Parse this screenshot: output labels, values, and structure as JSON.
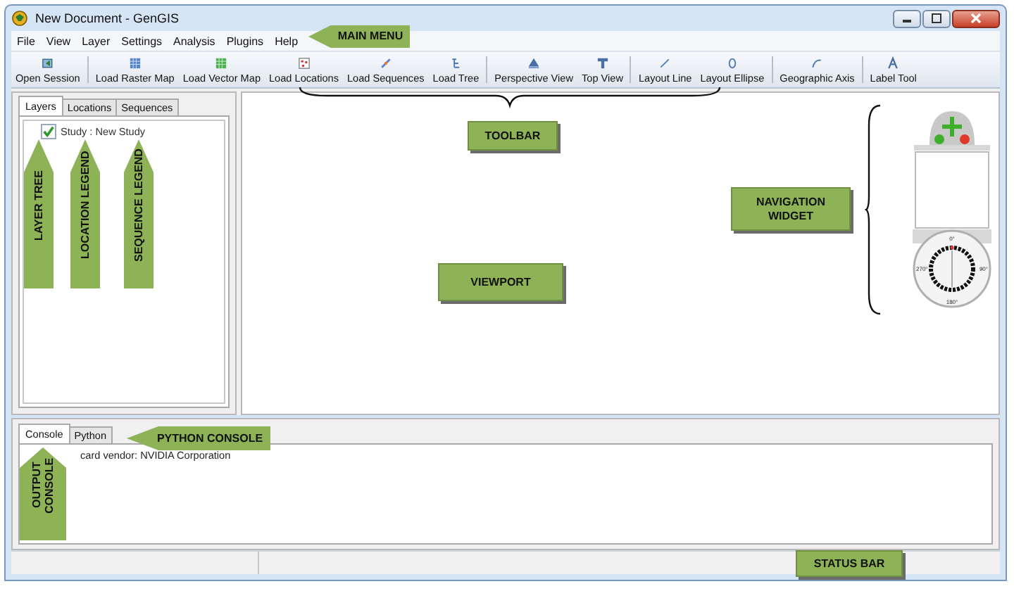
{
  "window": {
    "title": "New Document - GenGIS"
  },
  "menu": [
    "File",
    "View",
    "Layer",
    "Settings",
    "Analysis",
    "Plugins",
    "Help"
  ],
  "toolbar": [
    [
      "Open Session"
    ],
    [
      "Load Raster Map",
      "Load Vector Map",
      "Load Locations",
      "Load Sequences",
      "Load Tree"
    ],
    [
      "Perspective View",
      "Top View"
    ],
    [
      "Layout Line",
      "Layout Ellipse"
    ],
    [
      "Geographic Axis"
    ],
    [
      "Label Tool"
    ]
  ],
  "side_tabs": [
    {
      "label": "Layers",
      "selected": true
    },
    {
      "label": "Locations",
      "selected": false
    },
    {
      "label": "Sequences",
      "selected": false
    }
  ],
  "layer_tree": [
    {
      "label": "Study : New Study",
      "checked": true
    }
  ],
  "navigation": {
    "compass_labels": [
      "0°",
      "90°",
      "180°",
      "270°"
    ]
  },
  "console_tabs": [
    {
      "label": "Console",
      "selected": true
    },
    {
      "label": "Python",
      "selected": false
    }
  ],
  "console_lines": [
    "card vendor: NVIDIA Corporation"
  ],
  "annotations": [
    {
      "kind": "left",
      "text": "MAIN MENU"
    },
    {
      "kind": "box",
      "text": "TOOLBAR"
    },
    {
      "kind": "up",
      "text": "LAYER TREE"
    },
    {
      "kind": "up",
      "text": "LOCATION LEGEND"
    },
    {
      "kind": "up",
      "text": "SEQUENCE LEGEND"
    },
    {
      "kind": "box",
      "text": "VIEWPORT"
    },
    {
      "kind": "box",
      "text": "NAVIGATION WIDGET"
    },
    {
      "kind": "left",
      "text": "PYTHON CONSOLE"
    },
    {
      "kind": "up",
      "text": "OUTPUT CONSOLE"
    },
    {
      "kind": "box",
      "text": "STATUS BAR"
    }
  ]
}
